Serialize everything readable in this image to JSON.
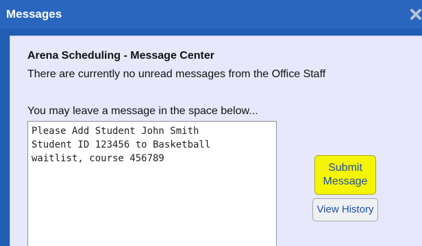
{
  "window": {
    "title": "Messages"
  },
  "panel": {
    "heading": "Arena Scheduling - Message Center",
    "status_text": "There are currently no unread messages from the Office Staff",
    "prompt_text": "You may leave a message in the space below...",
    "message_value": "Please Add Student John Smith\nStudent ID 123456 to Basketball\nwaitlist, course 456789"
  },
  "buttons": {
    "submit_line1": "Submit",
    "submit_line2": "Message",
    "history_label": "View History"
  },
  "colors": {
    "titlebar": "#2a66bd",
    "panel_bg": "#e8e8fc",
    "submit_bg": "#f5f500",
    "link_text": "#1f4fa8"
  },
  "icons": {
    "close": "close-icon"
  }
}
